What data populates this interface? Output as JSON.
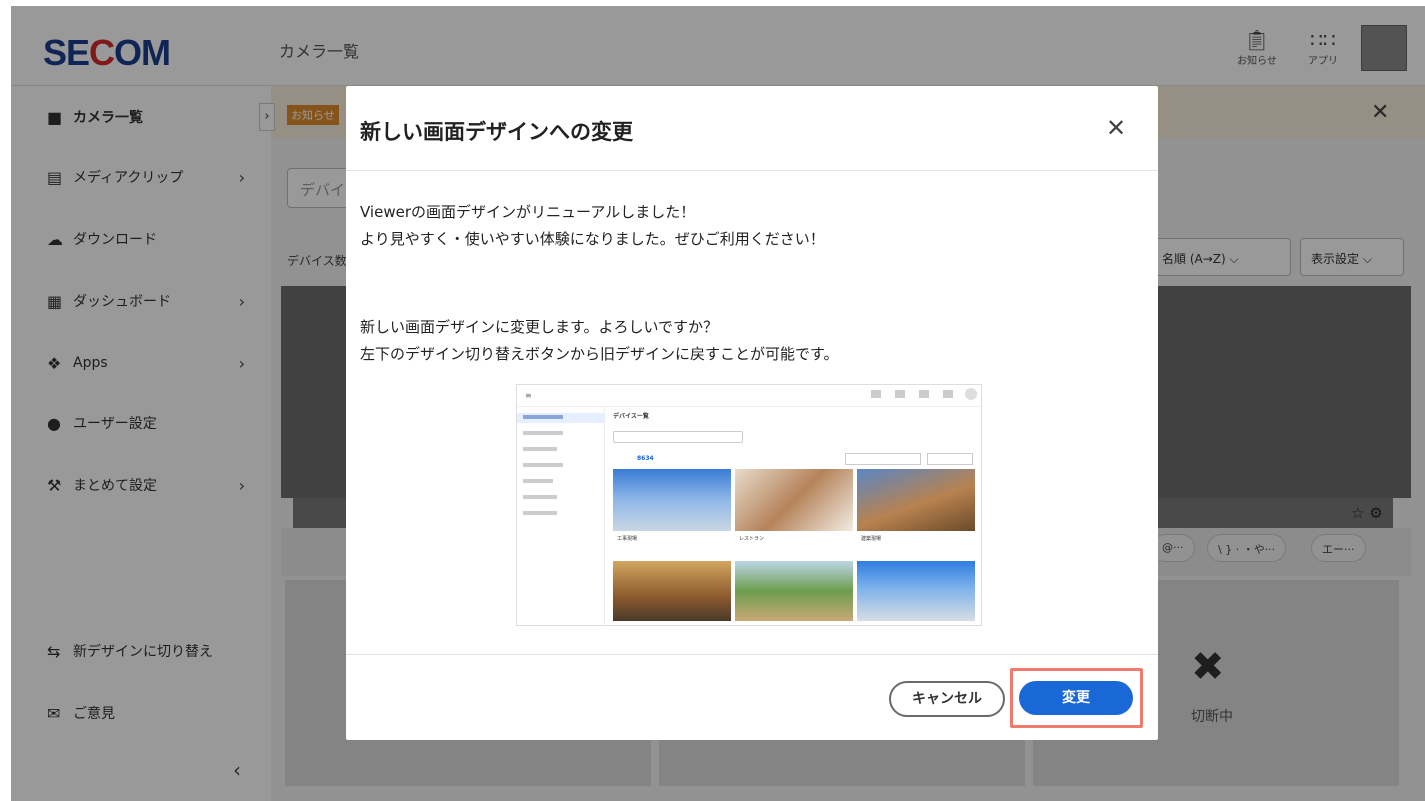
{
  "header": {
    "logo": {
      "prefix": "SE",
      "red": "C",
      "suffix": "OM"
    },
    "page_title": "カメラ一覧",
    "notifications_label": "お知らせ",
    "apps_label": "アプリ"
  },
  "sidebar": {
    "items": [
      {
        "label": "カメラ一覧",
        "icon": "video-camera-icon"
      },
      {
        "label": "メディアクリップ",
        "icon": "film-icon"
      },
      {
        "label": "ダウンロード",
        "icon": "cloud-download-icon"
      },
      {
        "label": "ダッシュボード",
        "icon": "dashboard-icon"
      },
      {
        "label": "Apps",
        "icon": "apps-cubes-icon"
      },
      {
        "label": "ユーザー設定",
        "icon": "user-icon"
      },
      {
        "label": "まとめて設定",
        "icon": "wrench-icon"
      }
    ],
    "switch_design": "新デザインに切り替え",
    "feedback": "ご意見"
  },
  "main": {
    "notice_badge": "お知らせ",
    "search_placeholder": "デバイ",
    "device_label": "デバイス数",
    "sort_label": "名順 (A→Z)",
    "display_settings": "表示設定",
    "chips": [
      "@···",
      "\\ } · ・や···",
      "エー···"
    ],
    "offline_label": "切断中"
  },
  "modal": {
    "title": "新しい画面デザインへの変更",
    "line1": "Viewerの画面デザインがリニューアルしました！",
    "line2": "より見やすく・使いやすい体験になりました。ぜひご利用ください！",
    "line3": "新しい画面デザインに変更します。よろしいですか？",
    "line4": "左下のデザイン切り替えボタンから旧デザインに戻すことが可能です。",
    "cancel_label": "キャンセル",
    "confirm_label": "変更"
  },
  "preview": {
    "page_title": "デバイスー覧",
    "device_count": "8634",
    "cards": [
      "工事現場",
      "レストラン",
      "建築現場"
    ]
  }
}
